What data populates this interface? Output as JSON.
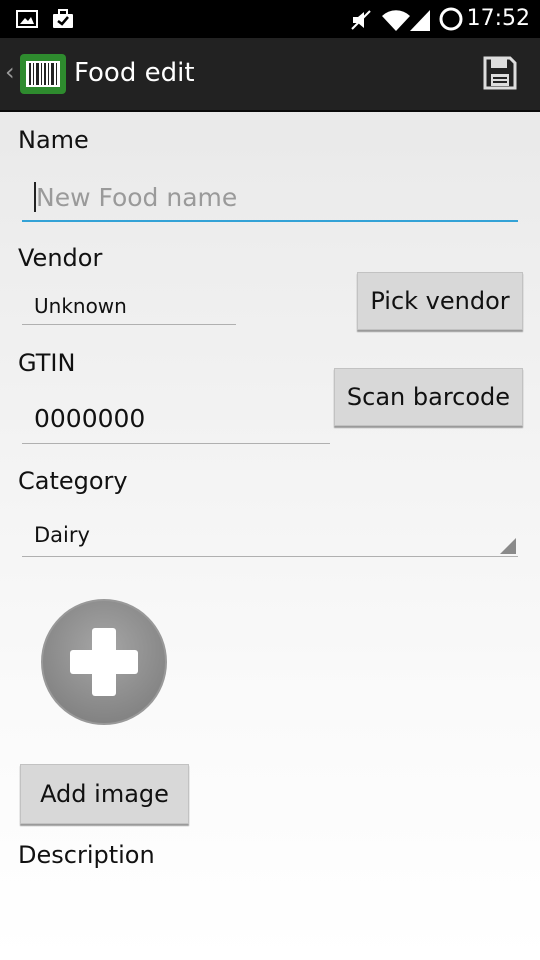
{
  "status_bar": {
    "time": "17:52",
    "icons": [
      "image-notification-icon",
      "briefcase-check-icon",
      "mute-icon",
      "wifi-icon",
      "signal-icon",
      "sync-icon"
    ]
  },
  "action_bar": {
    "title": "Food edit",
    "app_icon": "barcode-icon",
    "save_icon": "floppy-disk-icon"
  },
  "form": {
    "name_label": "Name",
    "name_value": "",
    "name_placeholder": "New Food name",
    "vendor_label": "Vendor",
    "vendor_value": "Unknown",
    "pick_vendor_label": "Pick vendor",
    "gtin_label": "GTIN",
    "gtin_value": "0000000",
    "scan_barcode_label": "Scan barcode",
    "category_label": "Category",
    "category_value": "Dairy",
    "add_image_label": "Add image",
    "description_label": "Description"
  },
  "colors": {
    "accent": "#33a2d6",
    "action_bar": "#222222",
    "app_icon_green": "#2e8b2e"
  }
}
